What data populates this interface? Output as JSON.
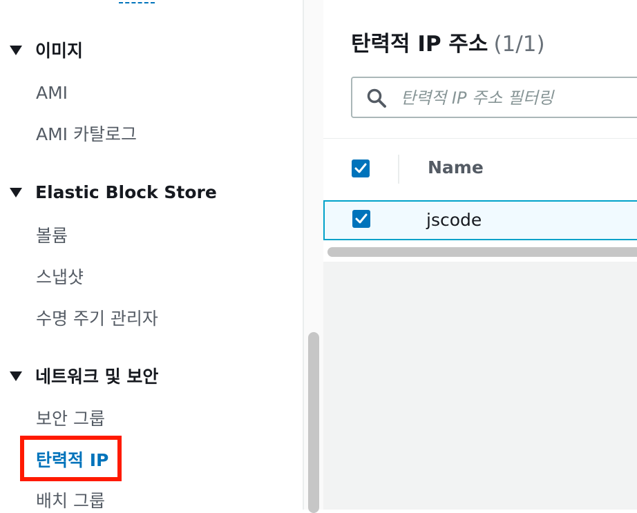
{
  "sidebar": {
    "sections": [
      {
        "label": "이미지",
        "items": [
          "AMI",
          "AMI 카탈로그"
        ]
      },
      {
        "label": "Elastic Block Store",
        "items": [
          "볼륨",
          "스냅샷",
          "수명 주기 관리자"
        ]
      },
      {
        "label": "네트워크 및 보안",
        "items": [
          "보안 그룹",
          "탄력적 IP",
          "배치 그룹"
        ]
      }
    ],
    "active_item": "탄력적 IP"
  },
  "main": {
    "title": "탄력적 IP 주소",
    "count": "(1/1)",
    "search_placeholder": "탄력적 IP 주소 필터링",
    "columns": [
      "Name"
    ],
    "rows": [
      {
        "name": "jscode",
        "selected": true
      }
    ]
  },
  "colors": {
    "accent": "#0073bb",
    "highlight_box": "#ff1a00",
    "selected_row_border": "#00a1c9"
  }
}
